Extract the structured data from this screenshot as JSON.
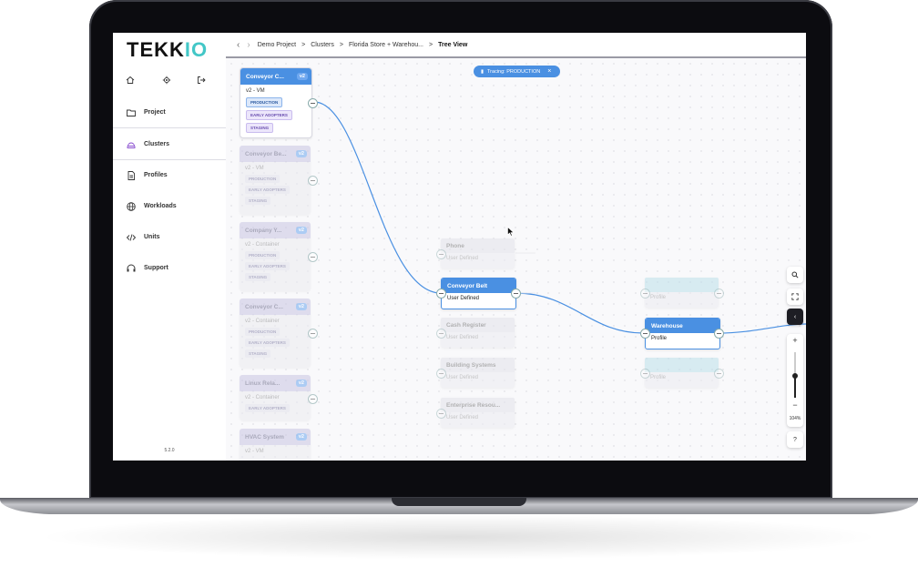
{
  "app": {
    "logo_main": "TEKK",
    "logo_accent": "IO",
    "version": "5.2.0"
  },
  "colors": {
    "accent": "#4a90e2",
    "brand": "#43c7c7",
    "tag_purple": "#6a4fb0"
  },
  "top_icons": [
    "home-icon",
    "gear-icon",
    "logout-icon"
  ],
  "sidebar": {
    "items": [
      {
        "label": "Project",
        "icon": "folder-icon"
      },
      {
        "label": "Clusters",
        "icon": "cluster-icon"
      },
      {
        "label": "Profiles",
        "icon": "document-icon"
      },
      {
        "label": "Workloads",
        "icon": "globe-icon"
      },
      {
        "label": "Units",
        "icon": "code-icon"
      },
      {
        "label": "Support",
        "icon": "headset-icon"
      }
    ]
  },
  "breadcrumb": {
    "items": [
      "Demo Project",
      "Clusters",
      "Florida Store + Warehou..."
    ],
    "current": "Tree View"
  },
  "tracing": {
    "label": "Tracing: PRODUCTION"
  },
  "clusters": [
    {
      "title": "Conveyor C...",
      "version": "v2",
      "subtitle": "v2 - VM",
      "tags": [
        "PRODUCTION",
        "EARLY ADOPTERS",
        "STAGING"
      ]
    },
    {
      "title": "Conveyor Be...",
      "version": "v2",
      "subtitle": "v2 - VM",
      "tags": [
        "PRODUCTION",
        "EARLY ADOPTERS",
        "STAGING"
      ]
    },
    {
      "title": "Company Y...",
      "version": "v2",
      "subtitle": "v2 - Container",
      "tags": [
        "PRODUCTION",
        "EARLY ADOPTERS",
        "STAGING"
      ]
    },
    {
      "title": "Conveyor C...",
      "version": "v2",
      "subtitle": "v2 - Container",
      "tags": [
        "PRODUCTION",
        "EARLY ADOPTERS",
        "STAGING"
      ]
    },
    {
      "title": "Linux Rela...",
      "version": "v2",
      "subtitle": "v2 - Container",
      "tags": [
        "EARLY ADOPTERS"
      ]
    },
    {
      "title": "HVAC System",
      "version": "v2",
      "subtitle": "v2 - VM",
      "tags": []
    }
  ],
  "units": [
    {
      "title": "Phone",
      "subtitle": "User Defined"
    },
    {
      "title": "Conveyor Belt",
      "subtitle": "User Defined"
    },
    {
      "title": "Cash Register",
      "subtitle": "User Defined"
    },
    {
      "title": "Building Systems",
      "subtitle": "User Defined"
    },
    {
      "title": "Enterprise Resou...",
      "subtitle": "User Defined"
    }
  ],
  "profiles": [
    {
      "title": "",
      "subtitle": "Profile"
    },
    {
      "title": "Warehouse",
      "subtitle": "Profile"
    },
    {
      "title": "",
      "subtitle": "Profile"
    }
  ],
  "controls": {
    "zoom_percent": "104%",
    "zoom_fraction": 0.48,
    "plus": "+",
    "minus": "−",
    "help": "?"
  }
}
